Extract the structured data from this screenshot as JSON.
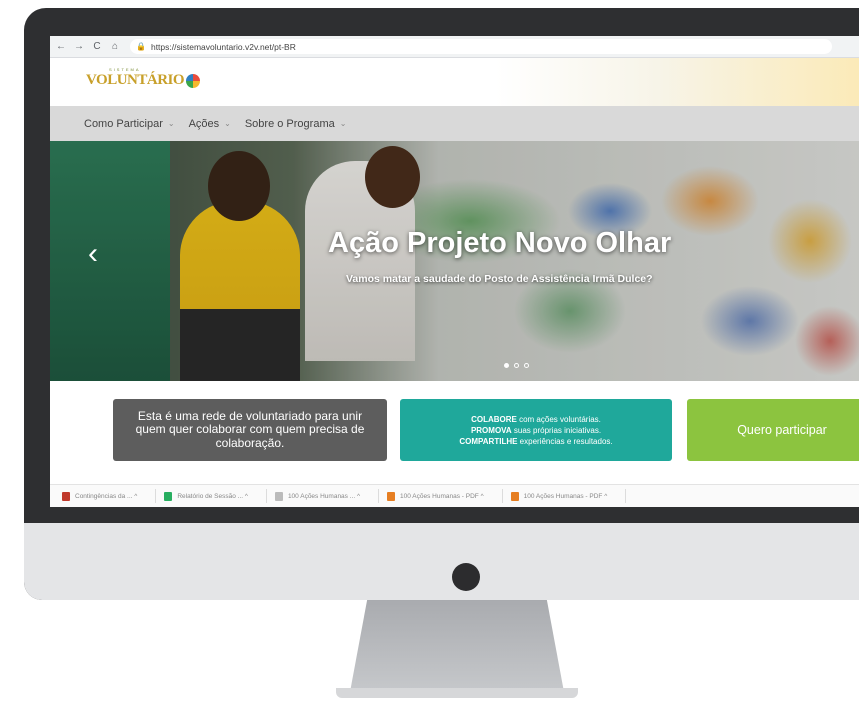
{
  "browser": {
    "back": "←",
    "forward": "→",
    "reload": "C",
    "home": "⌂",
    "url": "https://sistemavoluntario.v2v.net/pt-BR"
  },
  "site": {
    "logo_top": "SISTEMA",
    "logo_text": "VOLUNTÁRIO"
  },
  "nav": {
    "items": [
      {
        "label": "Como Participar"
      },
      {
        "label": "Ações"
      },
      {
        "label": "Sobre o Programa"
      }
    ]
  },
  "hero": {
    "title": "Ação Projeto Novo Olhar",
    "subtitle": "Vamos matar a saudade do Posto de Assistência Irmã Dulce?",
    "prev": "‹",
    "slides_total": 3,
    "active_slide": 1
  },
  "boxes": {
    "gray_text": "Esta é uma rede de voluntariado para unir quem quer colaborar com quem precisa de colaboração.",
    "teal_line1_bold": "COLABORE",
    "teal_line1_rest": " com ações voluntárias.",
    "teal_line2_bold": "PROMOVA",
    "teal_line2_rest": " suas próprias iniciativas.",
    "teal_line3_bold": "COMPARTILHE",
    "teal_line3_rest": " experiências e resultados.",
    "green_text": "Quero participar"
  },
  "strip": {
    "items": [
      {
        "label": "Contingências da ... ^",
        "color": "#c0392b"
      },
      {
        "label": "Relatório de Sessão ... ^",
        "color": "#27ae60"
      },
      {
        "label": "100 Ações Humanas ... ^",
        "color": "#bbbbbb"
      },
      {
        "label": "100 Ações Humanas - PDF ^",
        "color": "#e67e22"
      },
      {
        "label": "100 Ações Humanas - PDF ^",
        "color": "#e67e22"
      }
    ]
  }
}
